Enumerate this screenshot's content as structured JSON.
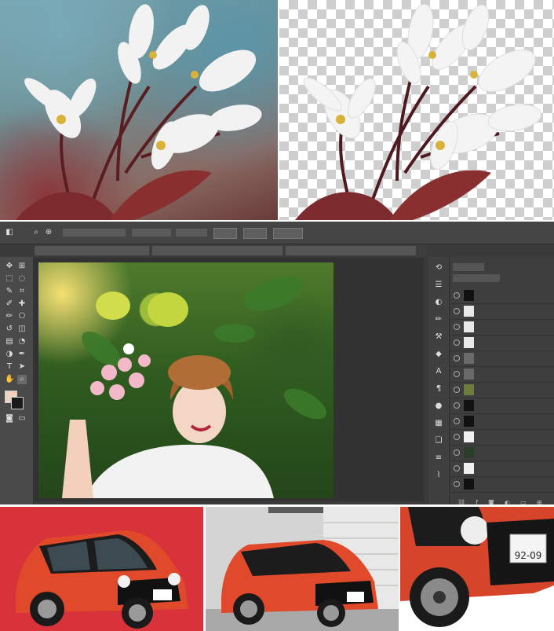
{
  "top": {
    "left_panel": "flower photo with blurred background",
    "right_panel": "flower cutout on transparent checkerboard"
  },
  "photoshop": {
    "options_bar": {
      "items": [
        "",
        "",
        "",
        "",
        "",
        "",
        "",
        ""
      ]
    },
    "document_tabs": [
      "",
      "",
      ""
    ],
    "layers_panel": {
      "header": "",
      "blend_mode": "",
      "layers": [
        {
          "name": "",
          "thumb": "#111111"
        },
        {
          "name": "",
          "thumb": "#e8e8e8"
        },
        {
          "name": "",
          "thumb": "#e8e8e8"
        },
        {
          "name": "",
          "thumb": "#e8e8e8"
        },
        {
          "name": "",
          "thumb": "#6a6a6a"
        },
        {
          "name": "",
          "thumb": "#6a6a6a"
        },
        {
          "name": "",
          "thumb": "#6c7c3a"
        },
        {
          "name": "",
          "thumb": "#111111"
        },
        {
          "name": "",
          "thumb": "#111111"
        },
        {
          "name": "",
          "thumb": "#f0f0f0"
        },
        {
          "name": "",
          "thumb": "#2b3d2b"
        },
        {
          "name": "",
          "thumb": "#f0f0f0"
        },
        {
          "name": "",
          "thumb": "#111111"
        }
      ]
    },
    "colors": {
      "foreground": "#f1d2c0",
      "background": "#1a1a1a"
    }
  },
  "cars": {
    "plate": "92-09"
  }
}
